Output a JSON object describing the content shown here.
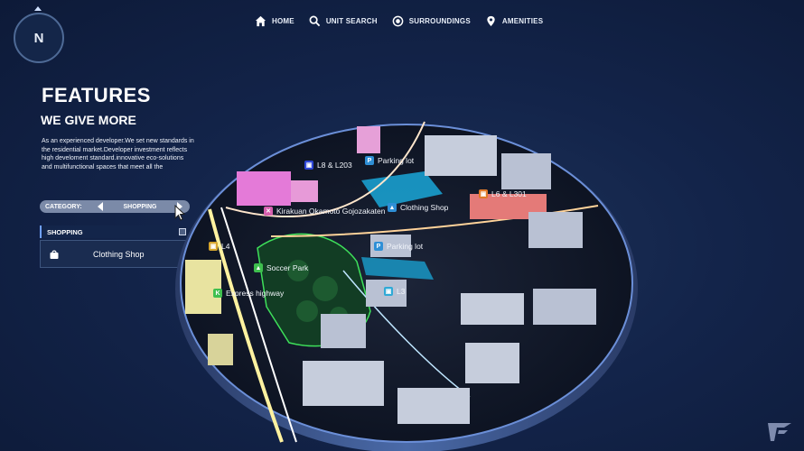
{
  "compass": {
    "label": "N"
  },
  "nav": [
    {
      "label": "HOME",
      "icon": "home-icon"
    },
    {
      "label": "UNIT SEARCH",
      "icon": "search-icon"
    },
    {
      "label": "SURROUNDINGS",
      "icon": "surroundings-icon"
    },
    {
      "label": "AMENITIES",
      "icon": "location-pin-icon"
    }
  ],
  "features": {
    "title": "FEATURES",
    "subtitle": "WE GIVE MORE",
    "description": "As an experienced developer.We set new standards in the residential market.Developer investment reflects high develoment standard.innovative eco-solutions and multifunctional spaces that meet all the"
  },
  "category": {
    "label": "CATEGORY:",
    "value": "SHOPPING"
  },
  "list": {
    "header": "SHOPPING",
    "items": [
      {
        "name": "Clothing Shop",
        "icon": "shopping-bag-icon"
      }
    ]
  },
  "map_labels": [
    {
      "text": "L8 & L203",
      "icon": "bus-icon",
      "color": "#2f47d6"
    },
    {
      "text": "Parking lot",
      "icon": "parking-icon",
      "color": "#2f8fd6"
    },
    {
      "text": "L6 & L301",
      "icon": "bus-icon",
      "color": "#e07a2a"
    },
    {
      "text": "Kirakuan Okamoto Gojozakaten",
      "icon": "restaurant-icon",
      "color": "#d65fae"
    },
    {
      "text": "Clothing Shop",
      "icon": "shopping-bag-icon",
      "color": "#2f8fd6"
    },
    {
      "text": "Parking lot",
      "icon": "parking-icon",
      "color": "#2f8fd6"
    },
    {
      "text": "L4",
      "icon": "bus-icon",
      "color": "#d6a62f"
    },
    {
      "text": "Soccer Park",
      "icon": "park-icon",
      "color": "#3fbf4f"
    },
    {
      "text": "Express highway",
      "icon": "highway-icon",
      "color": "#3fbf4f"
    },
    {
      "text": "L3",
      "icon": "bus-icon",
      "color": "#2fa9d6"
    }
  ],
  "colors": {
    "accent": "#6fa0ff",
    "background": "#13244a"
  }
}
